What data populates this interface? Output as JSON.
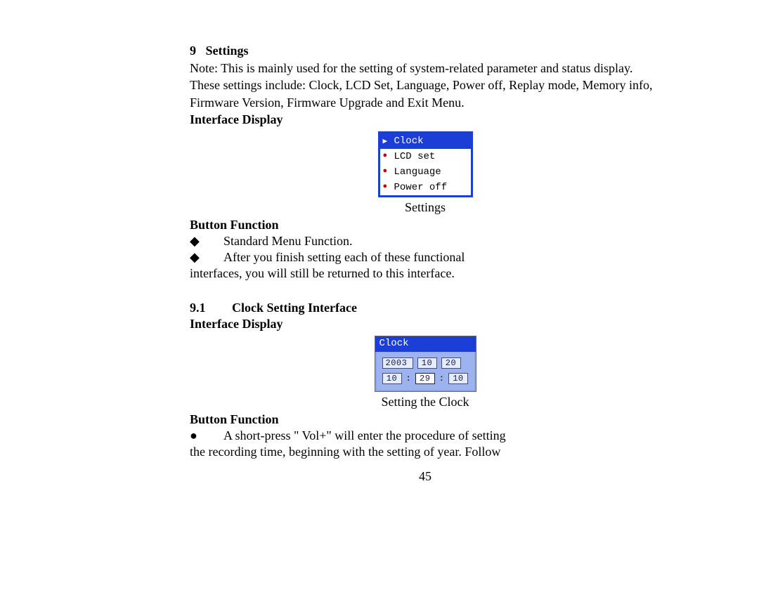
{
  "section9": {
    "num": "9",
    "title": "Settings",
    "note": "Note: This is mainly used for the setting of system-related parameter and status display. These settings include: Clock, LCD Set, Language, Power off, Replay mode, Memory info, Firmware Version, Firmware Upgrade and Exit Menu.",
    "interface_display_label": "Interface Display",
    "settings_menu": {
      "items": [
        {
          "label": "Clock",
          "selected": true
        },
        {
          "label": "LCD set",
          "selected": false
        },
        {
          "label": "Language",
          "selected": false
        },
        {
          "label": "Power off",
          "selected": false
        }
      ],
      "caption": "Settings"
    },
    "button_function_label": "Button Function",
    "bullets": [
      "Standard Menu Function.",
      "After you finish setting each of these functional"
    ],
    "bullet2_cont": "interfaces, you will still be returned to this interface."
  },
  "section91": {
    "num": "9.1",
    "title": "Clock Setting Interface",
    "interface_display_label": "Interface Display",
    "clock_lcd": {
      "title": "Clock",
      "date": {
        "year": "2003",
        "month": "10",
        "day": "20"
      },
      "time": {
        "hour": "10",
        "min": "29",
        "sec": "10"
      },
      "caption": "Setting the Clock"
    },
    "button_function_label": "Button Function",
    "bullets": [
      "A short-press \" Vol+\" will enter the procedure of setting"
    ],
    "bullet1_cont": "the recording time, beginning with the setting of year. Follow"
  },
  "page_number": "45"
}
